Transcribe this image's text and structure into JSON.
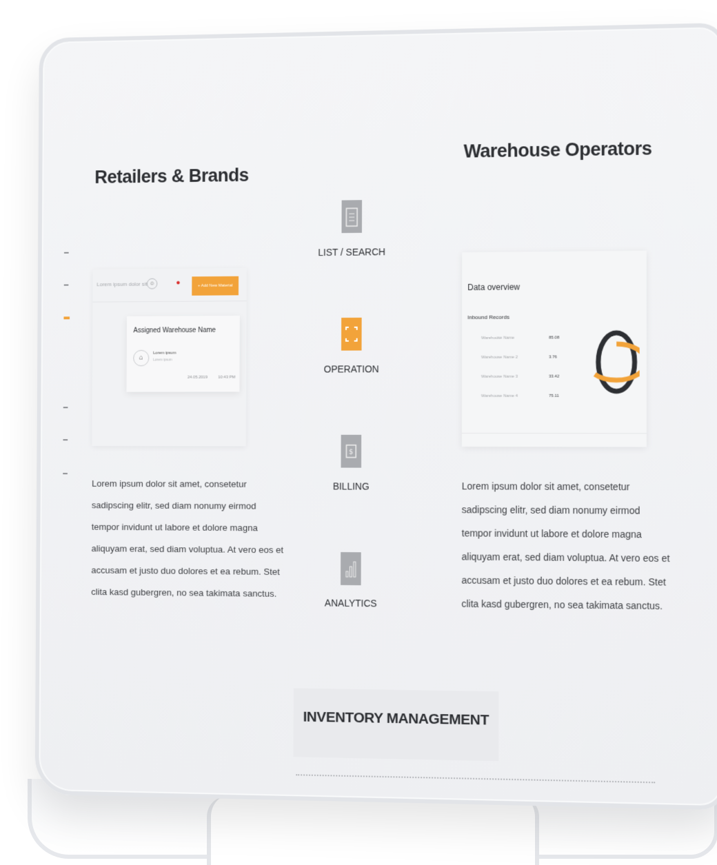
{
  "retailers": {
    "title": "Retailers & Brands",
    "search_placeholder": "Lorem ipsum dolor sit",
    "add_button": "+ Add New Material",
    "card_title": "Assigned Warehouse Name",
    "card_name": "Lorem ipsum",
    "card_sub": "Lorem ipsum",
    "card_date": "24.05.2019",
    "card_time": "10:43 PM",
    "paragraph_lines": [
      "Lorem ipsum dolor sit amet, consetetur",
      "sadipscing elitr, sed diam nonumy eirmod",
      "tempor invidunt ut labore et dolore magna",
      "aliquyam erat, sed diam voluptua. At vero eos et",
      "accusam et justo duo dolores et ea rebum. Stet",
      "clita kasd gubergren, no sea takimata sanctus."
    ]
  },
  "features": [
    {
      "label": "LIST / SEARCH",
      "icon": "clipboard-icon",
      "active": false
    },
    {
      "label": "OPERATION",
      "icon": "frame-icon",
      "active": true
    },
    {
      "label": "BILLING",
      "icon": "dollar-tag-icon",
      "active": false
    },
    {
      "label": "ANALYTICS",
      "icon": "bar-chart-icon",
      "active": false
    }
  ],
  "warehouse": {
    "title": "Warehouse Operators",
    "overview_title": "Data overview",
    "records_label": "Inbound Records",
    "rows": [
      {
        "name": "Warehouse Name",
        "value": "85.08"
      },
      {
        "name": "Warehouse Name 2",
        "value": "3.76"
      },
      {
        "name": "Warehouse Name 3",
        "value": "33.42"
      },
      {
        "name": "Warehouse Name 4",
        "value": "75.11"
      }
    ],
    "paragraph_lines": [
      "Lorem ipsum dolor sit amet, consetetur",
      "sadipscing elitr, sed diam nonumy eirmod",
      "tempor invidunt ut labore et dolore magna",
      "aliquyam erat, sed diam voluptua. At vero eos et",
      "accusam et justo duo dolores et ea rebum. Stet",
      "clita kasd gubergren, no sea takimata sanctus."
    ],
    "ring_fraction": 0.65
  },
  "inventory": {
    "title": "INVENTORY MANAGEMENT"
  },
  "colors": {
    "accent": "#f2a33a",
    "icon_grey": "#a9abaf",
    "ring_dark": "#2d2f33"
  }
}
